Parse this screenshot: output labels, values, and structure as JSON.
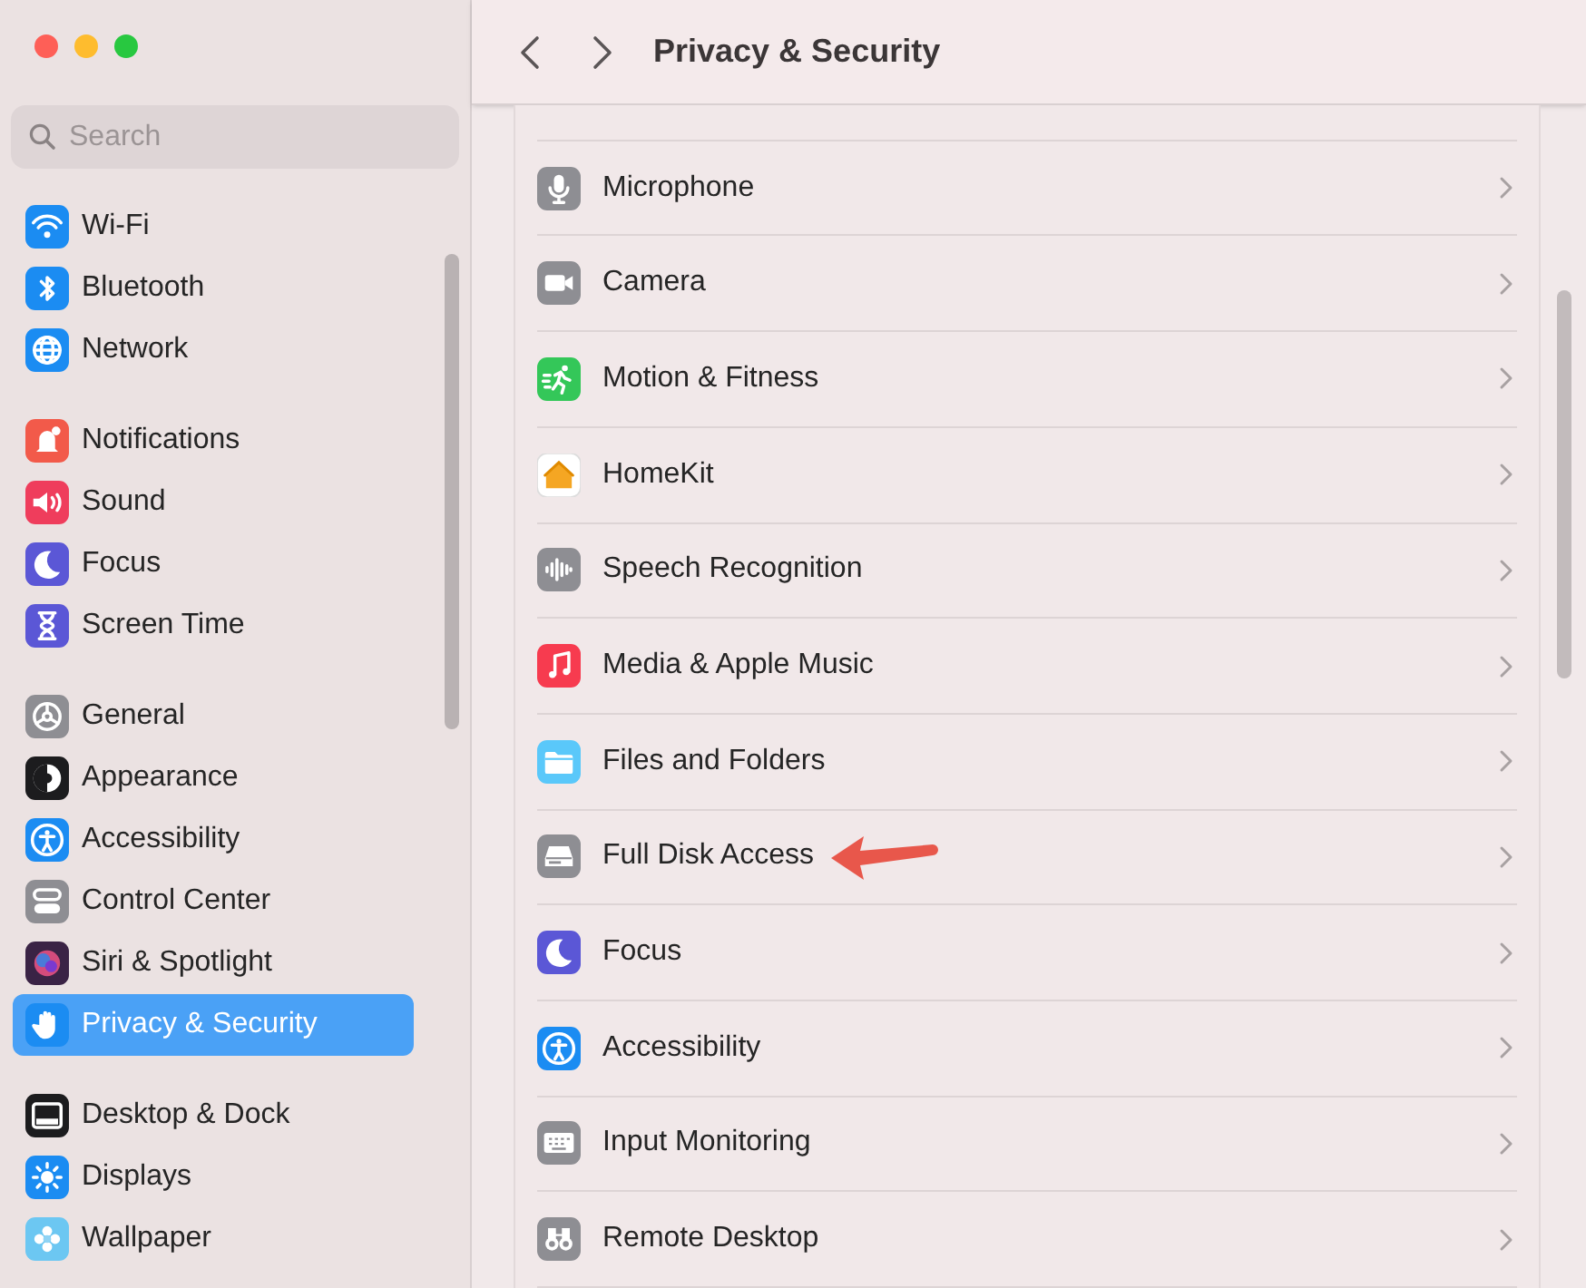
{
  "search": {
    "placeholder": "Search"
  },
  "sidebar": {
    "groups": [
      {
        "items": [
          {
            "label": "Wi-Fi",
            "selected": false
          },
          {
            "label": "Bluetooth",
            "selected": false
          },
          {
            "label": "Network",
            "selected": false
          }
        ]
      },
      {
        "items": [
          {
            "label": "Notifications",
            "selected": false
          },
          {
            "label": "Sound",
            "selected": false
          },
          {
            "label": "Focus",
            "selected": false
          },
          {
            "label": "Screen Time",
            "selected": false
          }
        ]
      },
      {
        "items": [
          {
            "label": "General",
            "selected": false
          },
          {
            "label": "Appearance",
            "selected": false
          },
          {
            "label": "Accessibility",
            "selected": false
          },
          {
            "label": "Control Center",
            "selected": false
          },
          {
            "label": "Siri & Spotlight",
            "selected": false
          },
          {
            "label": "Privacy & Security",
            "selected": true
          }
        ]
      },
      {
        "items": [
          {
            "label": "Desktop & Dock",
            "selected": false
          },
          {
            "label": "Displays",
            "selected": false
          },
          {
            "label": "Wallpaper",
            "selected": false
          }
        ]
      }
    ]
  },
  "header": {
    "title": "Privacy & Security"
  },
  "rows": [
    {
      "label": "Microphone",
      "marked": false
    },
    {
      "label": "Camera",
      "marked": false
    },
    {
      "label": "Motion & Fitness",
      "marked": false
    },
    {
      "label": "HomeKit",
      "marked": false
    },
    {
      "label": "Speech Recognition",
      "marked": false
    },
    {
      "label": "Media & Apple Music",
      "marked": false
    },
    {
      "label": "Files and Folders",
      "marked": false
    },
    {
      "label": "Full Disk Access",
      "marked": true
    },
    {
      "label": "Focus",
      "marked": false
    },
    {
      "label": "Accessibility",
      "marked": false
    },
    {
      "label": "Input Monitoring",
      "marked": false
    },
    {
      "label": "Remote Desktop",
      "marked": false
    }
  ]
}
